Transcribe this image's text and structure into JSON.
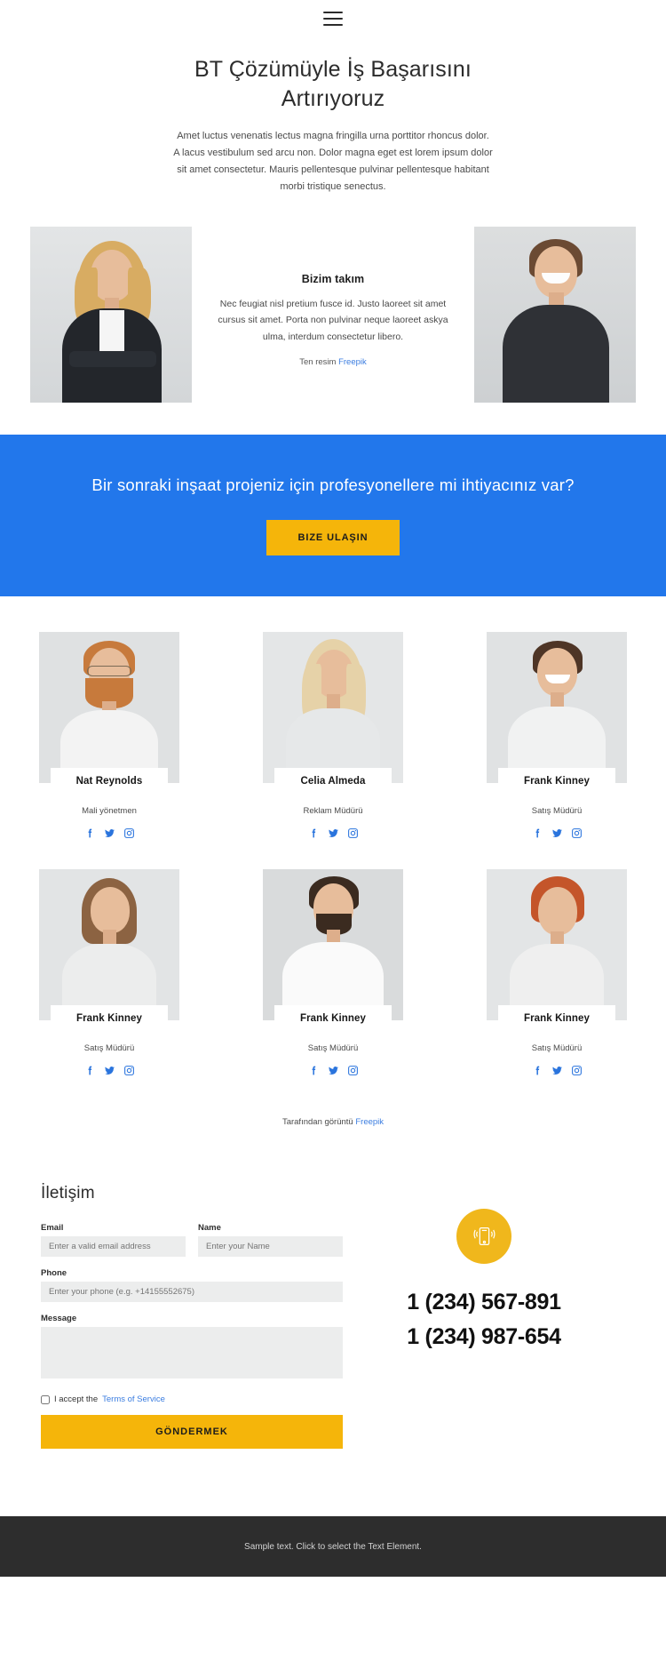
{
  "nav": {
    "menu_icon": "hamburger-menu-icon"
  },
  "hero": {
    "title": "BT Çözümüyle İş Başarısını Artırıyoruz",
    "paragraph": "Amet luctus venenatis lectus magna fringilla urna porttitor rhoncus dolor. A lacus vestibulum sed arcu non. Dolor magna eget est lorem ipsum dolor sit amet consectetur. Mauris pellentesque pulvinar pellentesque habitant morbi tristique senectus."
  },
  "intro": {
    "heading": "Bizim takım",
    "paragraph": "Nec feugiat nisl pretium fusce id. Justo laoreet sit amet cursus sit amet. Porta non pulvinar neque laoreet askya ulma, interdum consectetur libero.",
    "credit_prefix": "Ten resim ",
    "credit_link": "Freepik",
    "photo_left_alt": "woman-portrait-photo",
    "photo_right_alt": "man-portrait-photo"
  },
  "cta": {
    "heading": "Bir sonraki inşaat projeniz için profesyonellere mi ihtiyacınız var?",
    "button_label": "BIZE ULAŞIN",
    "background_color": "#2277eb",
    "button_color": "#f5b50a"
  },
  "team": {
    "members": [
      {
        "name": "Nat Reynolds",
        "role": "Mali yönetmen"
      },
      {
        "name": "Celia Almeda",
        "role": "Reklam Müdürü"
      },
      {
        "name": "Frank Kinney",
        "role": "Satış Müdürü"
      },
      {
        "name": "Frank Kinney",
        "role": "Satış Müdürü"
      },
      {
        "name": "Frank Kinney",
        "role": "Satış Müdürü"
      },
      {
        "name": "Frank Kinney",
        "role": "Satış Müdürü"
      }
    ],
    "social_icons": [
      "facebook-icon",
      "twitter-icon",
      "instagram-icon"
    ],
    "credit_prefix": "Tarafından görüntü ",
    "credit_link": "Freepik"
  },
  "contact": {
    "title": "İletişim",
    "fields": {
      "email_label": "Email",
      "email_placeholder": "Enter a valid email address",
      "name_label": "Name",
      "name_placeholder": "Enter your Name",
      "phone_label": "Phone",
      "phone_placeholder": "Enter your phone (e.g. +14155552675)",
      "message_label": "Message",
      "message_placeholder": ""
    },
    "accept_text": "I accept the ",
    "terms_link": "Terms of Service",
    "submit_label": "GÖNDERMEK",
    "phone_icon": "mobile-phone-icon",
    "phone_numbers": [
      "1 (234) 567-891",
      "1 (234) 987-654"
    ],
    "badge_color": "#f0b71c"
  },
  "footer": {
    "text": "Sample text. Click to select the Text Element."
  }
}
